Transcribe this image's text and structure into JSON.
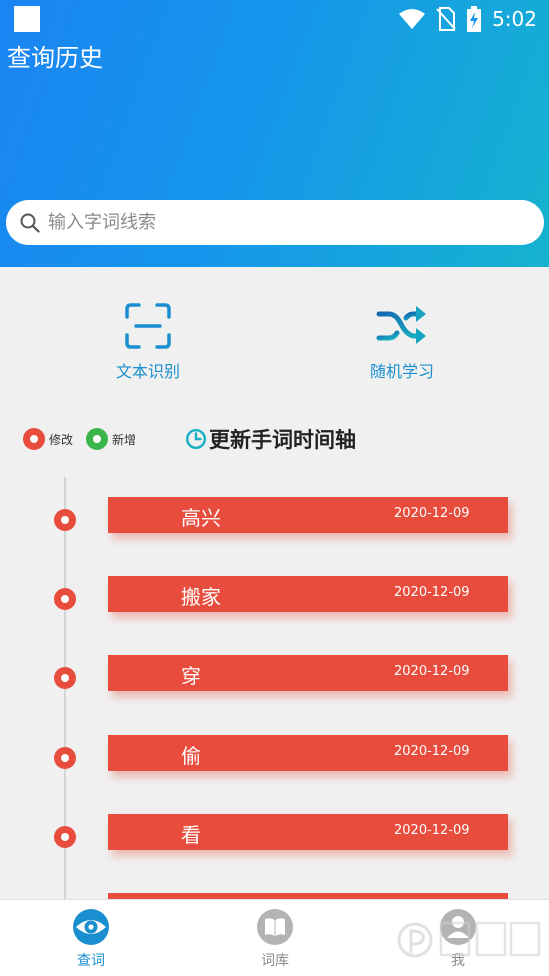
{
  "status_bar": {
    "time": "5:02"
  },
  "page_title": "查询历史",
  "search": {
    "placeholder": "输入字词线索"
  },
  "actions": [
    {
      "label": "文本识别",
      "icon": "scan-icon"
    },
    {
      "label": "随机学习",
      "icon": "shuffle-icon"
    }
  ],
  "legend": {
    "modified": "修改",
    "added": "新增"
  },
  "timeline": {
    "title": "更新手词时间轴",
    "items": [
      {
        "word": "高兴",
        "date": "2020-12-09"
      },
      {
        "word": "搬家",
        "date": "2020-12-09"
      },
      {
        "word": "穿",
        "date": "2020-12-09"
      },
      {
        "word": "偷",
        "date": "2020-12-09"
      },
      {
        "word": "看",
        "date": "2020-12-09"
      }
    ]
  },
  "bottom_nav": [
    {
      "label": "查词",
      "icon": "eye-icon"
    },
    {
      "label": "词库",
      "icon": "book-icon"
    },
    {
      "label": "我",
      "icon": "user-icon"
    }
  ],
  "colors": {
    "header_gradient_start": "#1a84f2",
    "header_gradient_end": "#16b3cf",
    "accent_blue": "#1a8fd0",
    "timeline_red": "#e74c3c",
    "added_green": "#3ab54a",
    "clock_teal": "#17b0c4"
  }
}
